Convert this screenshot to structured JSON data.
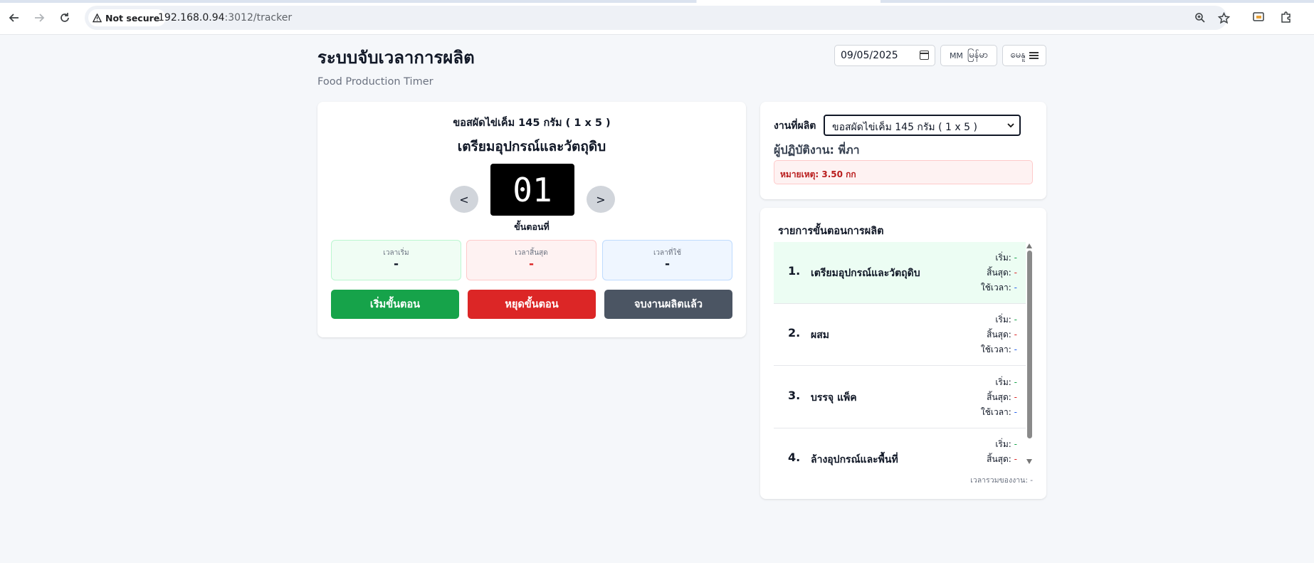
{
  "browser": {
    "security_label": "Not secure",
    "url_host": "192.168.0.94",
    "url_path": ":3012/tracker",
    "icons": [
      "back-icon",
      "forward-icon",
      "reload-icon",
      "warning-icon",
      "zoom-icon",
      "star-icon",
      "cast-icon",
      "extensions-icon"
    ]
  },
  "header": {
    "title": "ระบบจับเวลาการผลิต",
    "subtitle": "Food Production Timer",
    "date_value": "09/05/2025",
    "lang_code": "MM",
    "lang_label": "မြန်မာ",
    "menu_label": "မေနူ"
  },
  "timer": {
    "product": "ขอสผัดไข่เค็ม 145 กรัม ( 1 x 5 )",
    "step_name": "เตรียมอุปกรณ์และวัตถุดิบ",
    "prev_label": "<",
    "next_label": ">",
    "step_number": "01",
    "step_label": "ขั้นตอนที่",
    "start": {
      "label": "เวลาเริ่ม",
      "value": "-"
    },
    "end": {
      "label": "เวลาสิ้นสุด",
      "value": "-"
    },
    "used": {
      "label": "เวลาที่ใช้",
      "value": "-"
    },
    "buttons": {
      "start": "เริ่มขั้นตอน",
      "stop": "หยุดขั้นตอน",
      "finish": "จบงานผลิตแล้ว"
    }
  },
  "info": {
    "job_label": "งานที่ผลิต",
    "job_selected": "ขอสผัดไข่เค็ม 145 กรัม ( 1 x 5 )",
    "operator": "ผู้ปฏิบัติงาน: พี่ภา",
    "note": "หมายเหตุ: 3.50 กก"
  },
  "steps": {
    "title": "รายการขั้นตอนการผลิต",
    "start_label": "เริ่ม:",
    "end_label": "สิ้นสุด:",
    "used_label": "ใช้เวลา:",
    "items": [
      {
        "num": "1.",
        "name": "เตรียมอุปกรณ์และวัตถุดิบ",
        "start": "-",
        "end": "-",
        "used": "-"
      },
      {
        "num": "2.",
        "name": "ผสม",
        "start": "-",
        "end": "-",
        "used": "-"
      },
      {
        "num": "3.",
        "name": "บรรจุ แพ็ค",
        "start": "-",
        "end": "-",
        "used": "-"
      },
      {
        "num": "4.",
        "name": "ล้างอุปกรณ์และพื้นที่",
        "start": "-",
        "end": "-",
        "used": "-"
      }
    ],
    "total_label": "เวลารวมของงาน:",
    "total_value": "-"
  },
  "colors": {
    "green": "#16a34a",
    "red": "#dc2626",
    "gray": "#4b5563",
    "active_row": "#ecfdf3"
  }
}
